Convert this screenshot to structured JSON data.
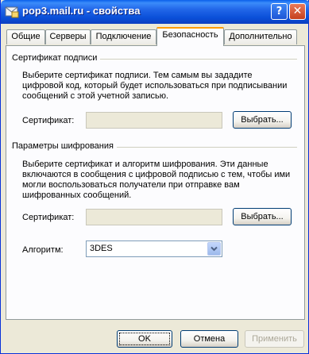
{
  "window": {
    "title": "pop3.mail.ru - свойства",
    "help_label": "?",
    "close_label": "✕"
  },
  "tabs": [
    {
      "label": "Общие"
    },
    {
      "label": "Серверы"
    },
    {
      "label": "Подключение"
    },
    {
      "label": "Безопасность"
    },
    {
      "label": "Дополнительно"
    }
  ],
  "signing": {
    "title": "Сертификат подписи",
    "description": "Выберите сертификат подписи. Тем самым вы зададите цифровой код, который будет использоваться при подписывании сообщений с этой учетной записью.",
    "cert_label": "Сертификат:",
    "cert_value": "",
    "select_button": "Выбрать..."
  },
  "encryption": {
    "title": "Параметры шифрования",
    "description": "Выберите сертификат и алгоритм шифрования. Эти данные включаются в сообщения с цифровой подписью с тем, чтобы ими могли воспользоваться получатели при отправке вам шифрованных сообщений.",
    "cert_label": "Сертификат:",
    "cert_value": "",
    "select_button": "Выбрать...",
    "algorithm_label": "Алгоритм:",
    "algorithm_value": "3DES"
  },
  "footer": {
    "ok": "OK",
    "cancel": "Отмена",
    "apply": "Применить"
  },
  "icons": {
    "app": "mail-account-icon",
    "help": "help-icon",
    "close": "close-icon",
    "dropdown": "chevron-down-icon"
  }
}
